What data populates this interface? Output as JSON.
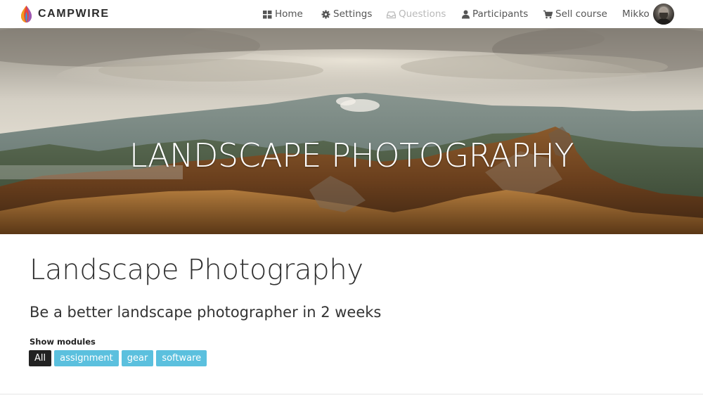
{
  "brand": {
    "name": "CAMPWIRE"
  },
  "nav": {
    "items": [
      {
        "label": "Home",
        "icon": "grid-icon"
      },
      {
        "label": "Settings",
        "icon": "gear-icon"
      },
      {
        "label": "Questions",
        "icon": "inbox-icon",
        "disabled": true
      },
      {
        "label": "Participants",
        "icon": "user-icon"
      },
      {
        "label": "Sell course",
        "icon": "cart-icon"
      }
    ],
    "user": {
      "name": "Mikko"
    }
  },
  "hero": {
    "title": "LANDSCAPE PHOTOGRAPHY"
  },
  "course": {
    "title": "Landscape Photography",
    "subtitle": "Be a better landscape photographer in 2 weeks"
  },
  "modules": {
    "label": "Show modules",
    "filters": [
      {
        "label": "All",
        "active": true
      },
      {
        "label": "assignment",
        "active": false
      },
      {
        "label": "gear",
        "active": false
      },
      {
        "label": "software",
        "active": false
      }
    ]
  },
  "colors": {
    "chip": "#5bc0de",
    "chip_active": "#222222",
    "nav_text": "#555555",
    "nav_disabled": "#b9b9b9"
  }
}
